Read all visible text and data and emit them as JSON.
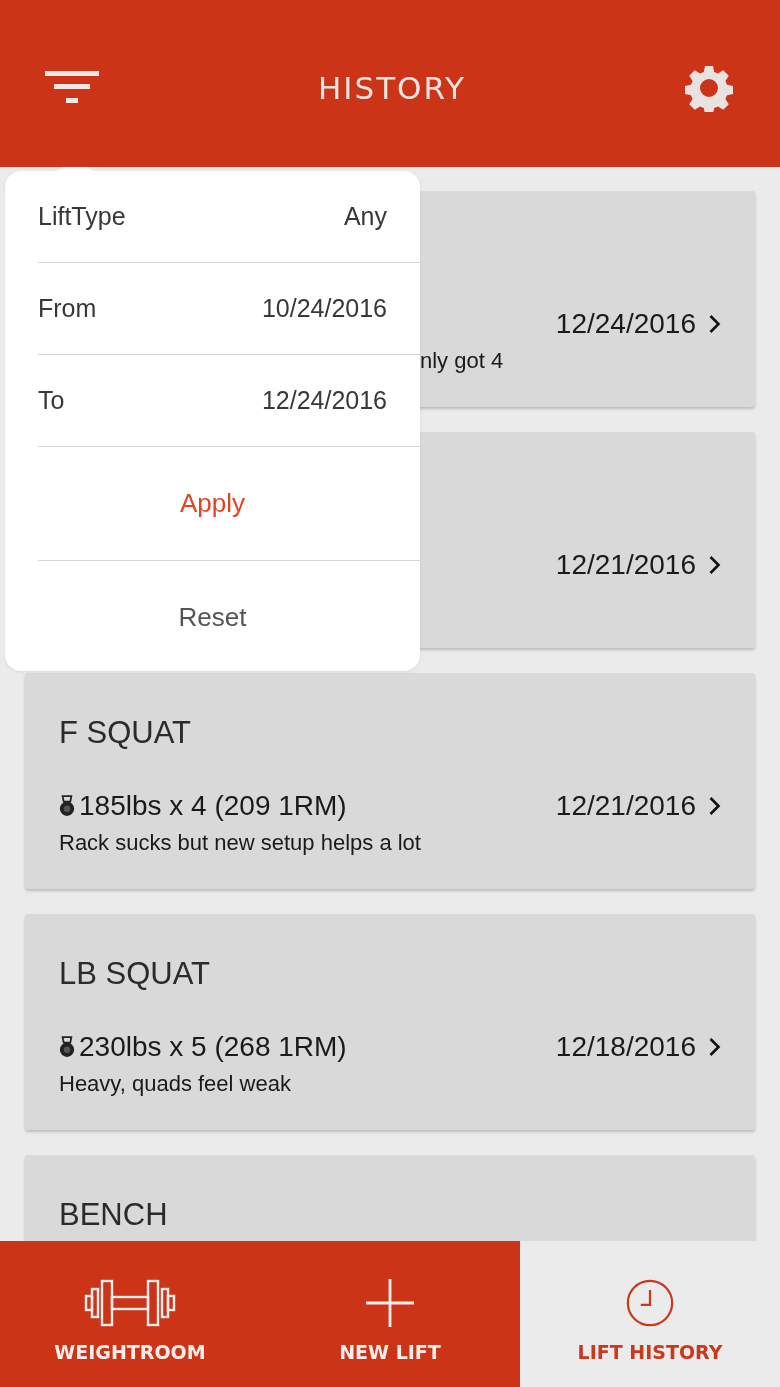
{
  "header": {
    "title": "HISTORY"
  },
  "filter_popup": {
    "rows": [
      {
        "label": "LiftType",
        "value": "Any"
      },
      {
        "label": "From",
        "value": "10/24/2016"
      },
      {
        "label": "To",
        "value": "12/24/2016"
      }
    ],
    "apply": "Apply",
    "reset": "Reset"
  },
  "lifts": [
    {
      "date": "12/24/2016",
      "note": "nly got 4"
    },
    {
      "date": "12/21/2016"
    },
    {
      "name": "F SQUAT",
      "result": "185lbs x 4 (209 1RM)",
      "date": "12/21/2016",
      "note": "Rack sucks but new setup helps a lot"
    },
    {
      "name": "LB SQUAT",
      "result": "230lbs x 5 (268 1RM)",
      "date": "12/18/2016",
      "note": "Heavy, quads feel weak"
    },
    {
      "name": "BENCH"
    }
  ],
  "nav": [
    {
      "label": "WEIGHTROOM",
      "selected": false
    },
    {
      "label": "NEW LIFT",
      "selected": false
    },
    {
      "label": "LIFT HISTORY",
      "selected": true
    }
  ]
}
